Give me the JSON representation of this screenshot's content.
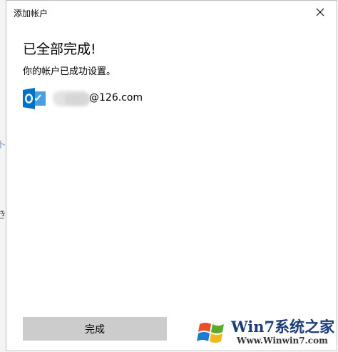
{
  "window": {
    "title": "添加帐户"
  },
  "background": {
    "top_text": "",
    "left_glyph_1": "ト",
    "left_glyph_2": "き"
  },
  "main": {
    "heading": "已全部完成!",
    "subheading": "你的帐户已成功设置。",
    "account": {
      "icon": "outlook-icon",
      "email_domain": "@126.com"
    }
  },
  "footer": {
    "done_label": "完成"
  },
  "watermark": {
    "brand": "Win7系统之家",
    "url": "Www.Winwin7.com"
  },
  "colors": {
    "outlook_blue": "#0072c6",
    "button_gray": "#cccccc",
    "watermark_blue": "#1a3d7a"
  }
}
